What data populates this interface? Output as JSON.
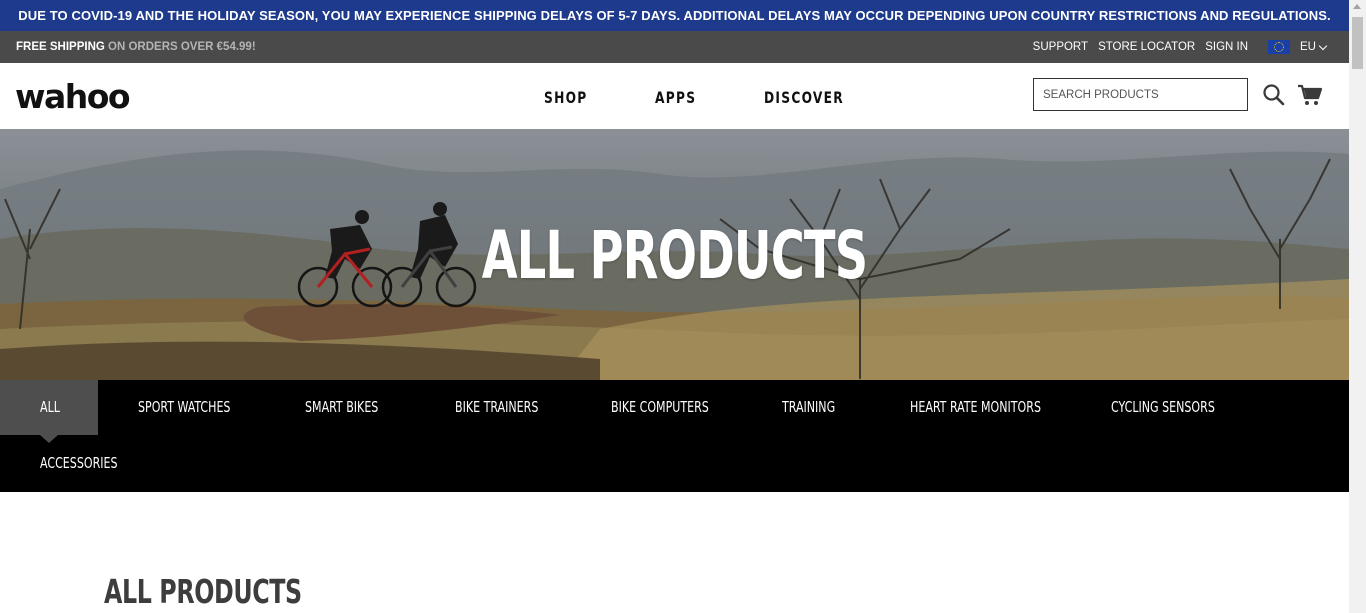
{
  "announcement": {
    "text": "DUE TO COVID-19 AND THE HOLIDAY SEASON, YOU MAY EXPERIENCE SHIPPING DELAYS OF 5-7 DAYS. ADDITIONAL DELAYS MAY OCCUR DEPENDING UPON COUNTRY RESTRICTIONS AND REGULATIONS."
  },
  "utility": {
    "shipping_strong": "FREE SHIPPING",
    "shipping_rest": " ON ORDERS OVER €54.99!",
    "links": [
      "SUPPORT",
      "STORE LOCATOR",
      "SIGN IN"
    ],
    "region": "EU",
    "flag_icon": "eu-flag-icon"
  },
  "header": {
    "logo": "wahoo",
    "nav": [
      "SHOP",
      "APPS",
      "DISCOVER"
    ],
    "search_placeholder": "SEARCH PRODUCTS",
    "search_icon": "search-icon",
    "cart_icon": "cart-icon"
  },
  "hero": {
    "title": "ALL PRODUCTS"
  },
  "categories": {
    "active": "ALL",
    "items": [
      "ALL",
      "SPORT WATCHES",
      "SMART BIKES",
      "BIKE TRAINERS",
      "BIKE COMPUTERS",
      "TRAINING",
      "HEART RATE MONITORS",
      "CYCLING SENSORS",
      "ACCESSORIES"
    ]
  },
  "section": {
    "title": "ALL PRODUCTS"
  },
  "colors": {
    "announcement_bg": "#1e3a8c",
    "utility_bg": "#4a4a4a",
    "category_bg": "#000000",
    "category_active_bg": "#4e4e4e"
  }
}
